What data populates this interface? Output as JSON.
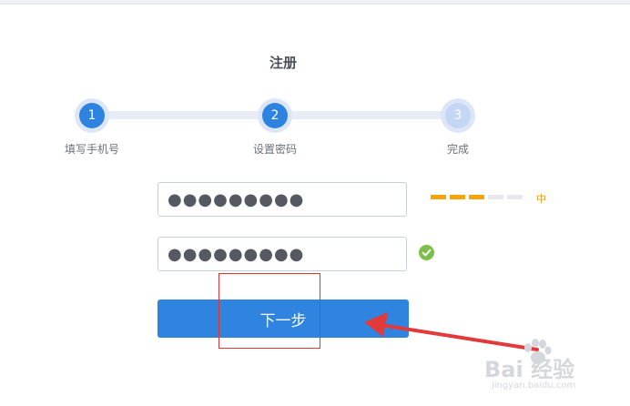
{
  "page": {
    "title": "注册"
  },
  "steps": [
    {
      "number": "1",
      "label": "填写手机号",
      "state": "done"
    },
    {
      "number": "2",
      "label": "设置密码",
      "state": "active"
    },
    {
      "number": "3",
      "label": "完成",
      "state": "pending"
    }
  ],
  "form": {
    "password": {
      "value": "●●●●●●●●●"
    },
    "confirm_password": {
      "value": "●●●●●●●●●"
    },
    "strength": {
      "filled_segments": 3,
      "total_segments": 5,
      "label": "中"
    },
    "next_button_label": "下一步"
  },
  "watermark": {
    "text": "Bai 经验",
    "sub": "jingyan.baidu.com"
  },
  "colors": {
    "accent": "#2f84e0",
    "strength": "#f4a50a",
    "check": "#7cbf4a",
    "annotation": "#e03535"
  }
}
